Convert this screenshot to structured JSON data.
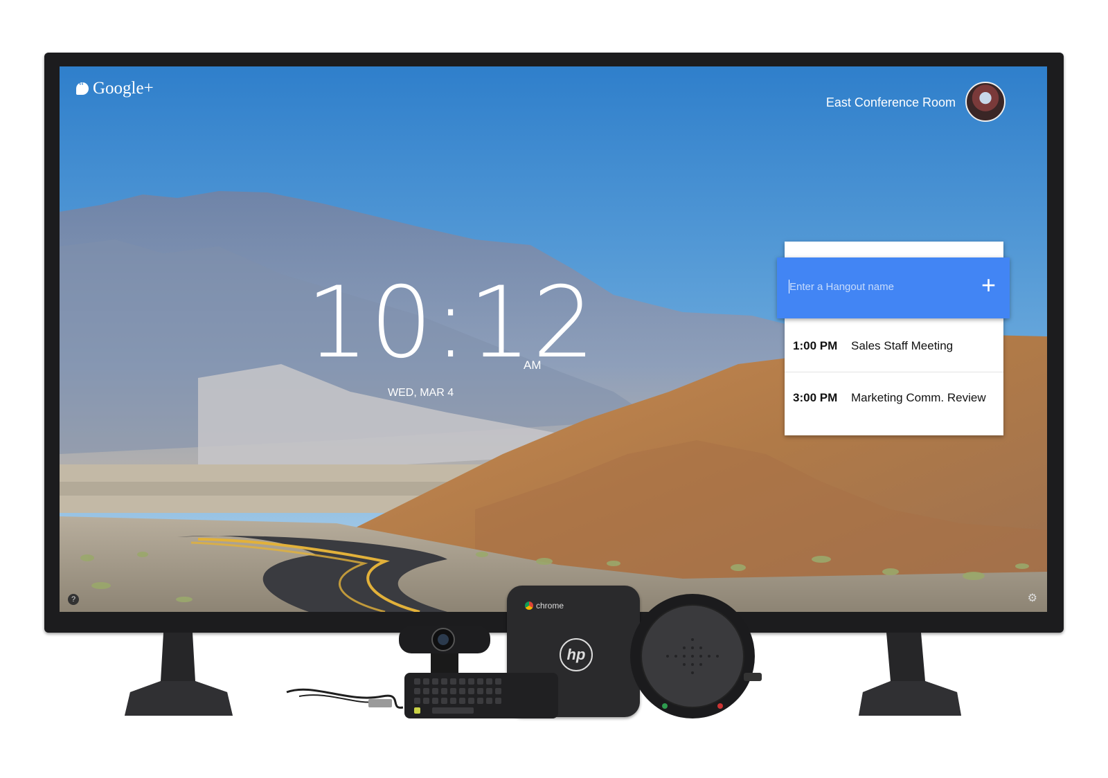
{
  "brand": {
    "logo_text": "Google+"
  },
  "header": {
    "room_name": "East Conference Room"
  },
  "clock": {
    "time": "10:12",
    "ampm": "AM",
    "date": "WED, MAR 4"
  },
  "hangout": {
    "placeholder": "Enter a Hangout name",
    "add_label": "+",
    "meetings": [
      {
        "time": "1:00 PM",
        "title": "Sales Staff Meeting"
      },
      {
        "time": "3:00 PM",
        "title": "Marketing Comm. Review"
      }
    ]
  },
  "footer": {
    "help_icon": "?",
    "settings_icon": "⚙"
  },
  "devices": {
    "chromebox_label": "chrome",
    "chromebox_logo": "hp"
  },
  "colors": {
    "hangout_bar": "#4285f4",
    "sky_top": "#2f7fcb",
    "sky_bottom": "#a9cce6",
    "bezel": "#1c1c1e"
  }
}
